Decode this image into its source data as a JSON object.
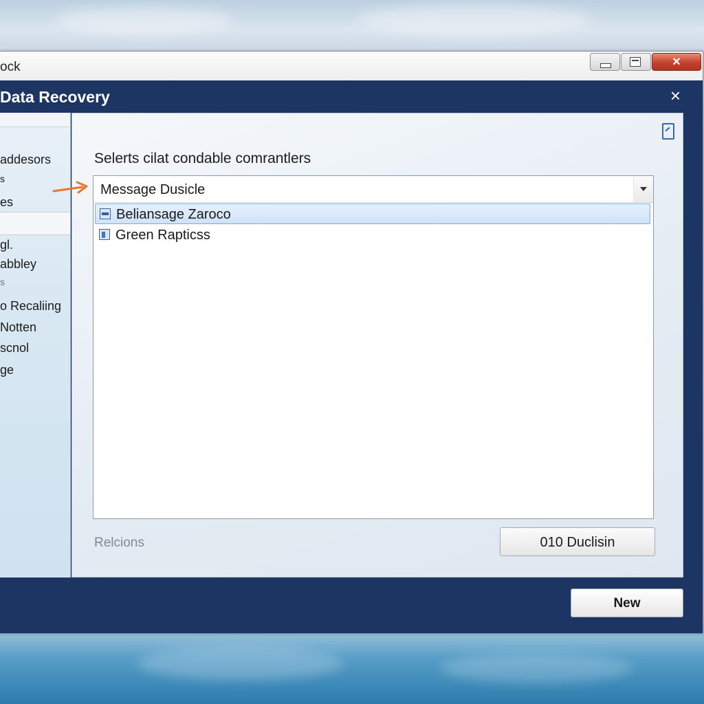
{
  "outer_window": {
    "title": "ock",
    "controls": {
      "minimize": "minimize",
      "maximize": "maximize",
      "close": "×"
    }
  },
  "dialog": {
    "title": "Data Recovery",
    "close_glyph": "×"
  },
  "sidebar": {
    "items": [
      {
        "label": "addesors"
      },
      {
        "label": "s"
      },
      {
        "label": "es"
      },
      {
        "label": "gl."
      },
      {
        "label": "abbley"
      },
      {
        "label": "s"
      },
      {
        "label": "o Recaliing"
      },
      {
        "label": "Notten"
      },
      {
        "label": "scnol"
      },
      {
        "label": "ge"
      }
    ]
  },
  "panel": {
    "prompt": "Selerts cilat condable comrantlers",
    "combo_value": "Message Dusicle",
    "list_items": [
      {
        "label": "Beliansage Zaroco",
        "selected": true,
        "icon": "window-icon"
      },
      {
        "label": "Green Rapticss",
        "selected": false,
        "icon": "document-icon"
      }
    ],
    "footer_label": "Relcions",
    "action_button": "010 Duclisin"
  },
  "new_button": "New",
  "colors": {
    "dialog_navy": "#1d3563",
    "annotation_arrow": "#e8772e",
    "selection": "#cfe2f8"
  }
}
